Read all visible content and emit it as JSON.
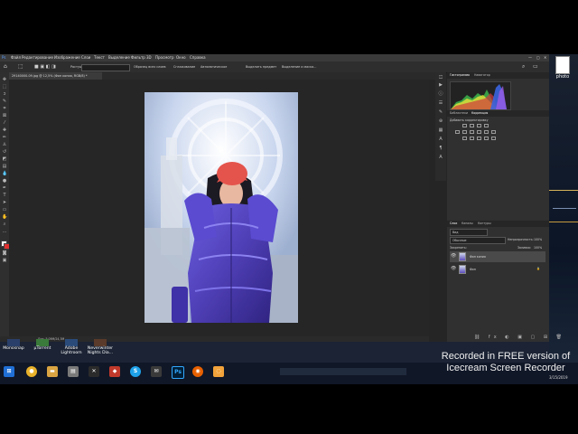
{
  "menu": {
    "items": [
      "Файл",
      "Редактирование",
      "Изображение",
      "Слои",
      "Текст",
      "Выделение",
      "Фильтр",
      "3D",
      "Просмотр",
      "Окно",
      "Справка"
    ]
  },
  "options": {
    "feather_label": "Растуш.:",
    "feather_value": "0 пикс",
    "style_label": "Нормальный",
    "sample_all": "Образец всех слоев",
    "smooth_edge": "Сглаживание",
    "auto_enhance": "Автоматическое",
    "select_subject": "Выделить предмет",
    "select_mask": "Выделение и маска..."
  },
  "document": {
    "tab_title": "29140000-09.jpg @ 12,5% (Фон копия, RGB/8) *",
    "status": "Док: 5,09М/24,3М"
  },
  "panels": {
    "histogram_tabs": [
      "Гистограмма",
      "Навигатор"
    ],
    "adjustment_tabs": [
      "Библиотеки",
      "Коррекция"
    ],
    "adjustment_hint": "Добавить корректировку",
    "layers_tabs": [
      "Слои",
      "Каналы",
      "Контуры"
    ],
    "kind_label": "Вид",
    "blend_mode": "Обычные",
    "opacity_label": "Непрозрачность:",
    "opacity_value": "100%",
    "lock_label": "Закрепить:",
    "fill_label": "Заливка:",
    "fill_value": "100%",
    "layers": [
      {
        "name": "Фон копия"
      },
      {
        "name": "Фон"
      }
    ]
  },
  "desktop": {
    "icons": [
      {
        "label": "Monosnap"
      },
      {
        "label": "µTorrent"
      },
      {
        "label": "Adobe Lightroom"
      },
      {
        "label": "Neverwinter Nights Dia..."
      }
    ],
    "right_icon_label": "photo"
  },
  "taskbar": {
    "apps": [
      "windows",
      "chrome",
      "folder",
      "files",
      "vortex",
      "git",
      "skype",
      "mail",
      "photoshop",
      "firefox",
      "app"
    ],
    "date": "3/15/2019"
  },
  "watermark": {
    "line1": "Recorded in FREE version of",
    "line2": "Icecream  Screen  Recorder"
  },
  "colors": {
    "ps_bg": "#262626",
    "jacket": "#4f3fb6",
    "hat": "#e4544c"
  }
}
